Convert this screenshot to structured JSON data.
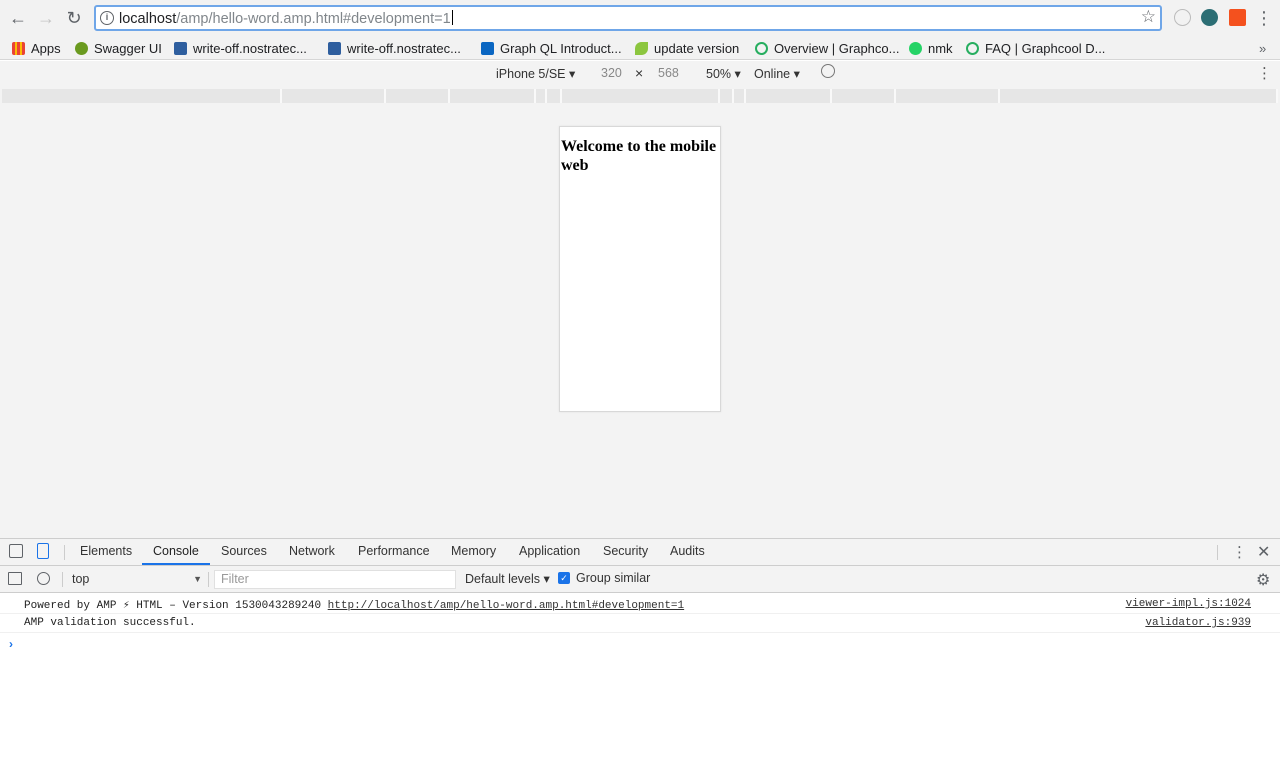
{
  "browser": {
    "url_host": "localhost",
    "url_path": "/amp/hello-word.amp.html#development=1"
  },
  "bookmarks": [
    {
      "label": "Apps",
      "icon": "apps-grid-icon",
      "color": "#4285f4"
    },
    {
      "label": "Swagger UI",
      "icon": "swagger-icon",
      "color": "#6a9a1f"
    },
    {
      "label": "write-off.nostratec...",
      "icon": "bookmark-favicon-icon",
      "color": "#2e5e9e"
    },
    {
      "label": "write-off.nostratec...",
      "icon": "bookmark-favicon-icon",
      "color": "#2e5e9e"
    },
    {
      "label": "Graph QL Introduct...",
      "icon": "linkedin-icon",
      "color": "#0a66c2"
    },
    {
      "label": "update version",
      "icon": "leaf-icon",
      "color": "#8cc63f"
    },
    {
      "label": "Overview | Graphco...",
      "icon": "graphcool-icon",
      "color": "#27ae60"
    },
    {
      "label": "nmk",
      "icon": "whatsapp-icon",
      "color": "#25d366"
    },
    {
      "label": "FAQ | Graphcool D...",
      "icon": "graphcool-icon",
      "color": "#27ae60"
    }
  ],
  "device_toolbar": {
    "device": "iPhone 5/SE",
    "width": "320",
    "height": "568",
    "zoom": "50%",
    "network": "Online"
  },
  "page": {
    "heading": "Welcome to the mobile web"
  },
  "devtools": {
    "tabs": [
      "Elements",
      "Console",
      "Sources",
      "Network",
      "Performance",
      "Memory",
      "Application",
      "Security",
      "Audits"
    ],
    "active_tab": "Console",
    "context": "top",
    "filter_placeholder": "Filter",
    "levels": "Default levels",
    "group_similar": "Group similar",
    "logs": [
      {
        "text": "Powered by AMP ⚡ HTML – Version 1530043289240 ",
        "link": "http://localhost/amp/hello-word.amp.html#development=1",
        "source": "viewer-impl.js:1024"
      },
      {
        "text": "AMP validation successful.",
        "link": "",
        "source": "validator.js:939"
      }
    ]
  },
  "colors": {
    "accent": "#1a73e8",
    "omnibox_focus": "#6fa6e8"
  }
}
